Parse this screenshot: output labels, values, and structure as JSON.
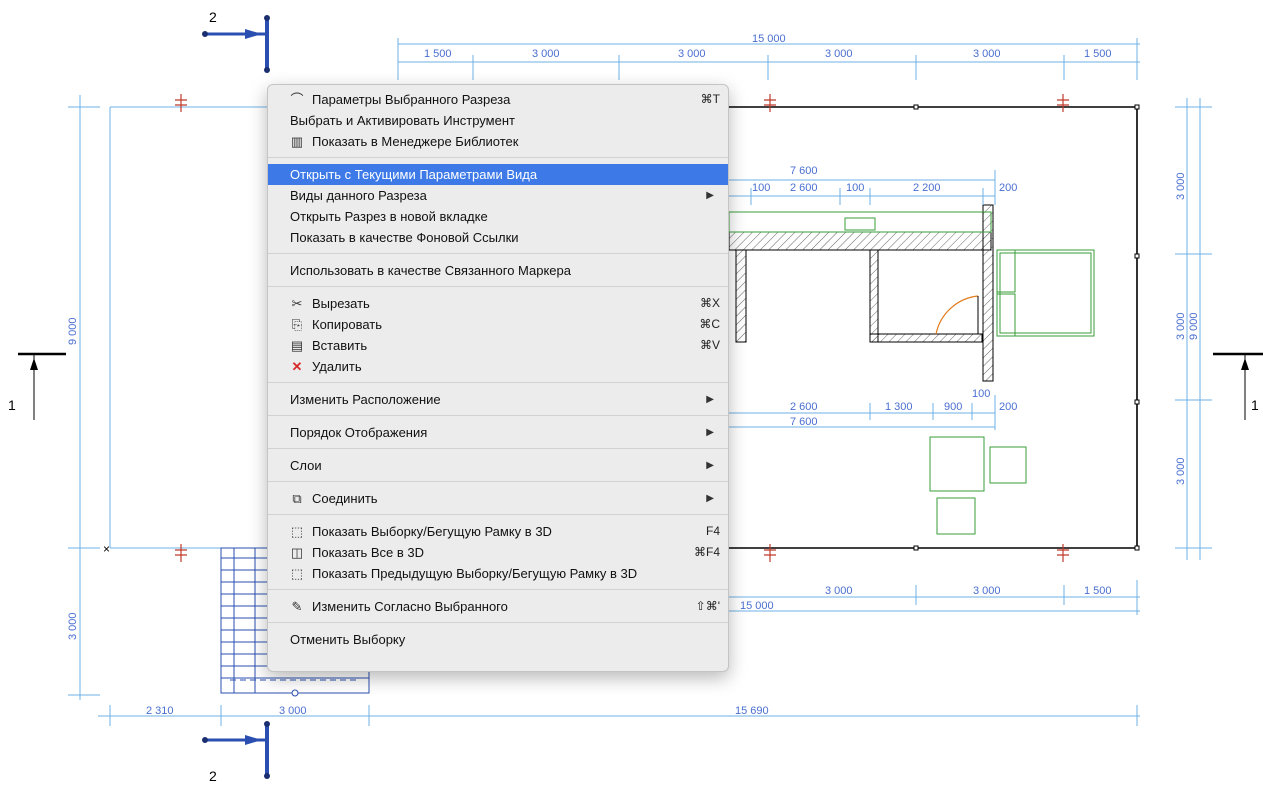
{
  "drawing": {
    "top_dims": {
      "total": "15 000",
      "segments": [
        "1 500",
        "3 000",
        "3 000",
        "3 000",
        "3 000",
        "1 500"
      ]
    },
    "bottom_dims": {
      "total": "15 000",
      "segments": [
        "3 000",
        "3 000",
        "1 500"
      ]
    },
    "bottom_outer_dims": [
      "2 310",
      "3 000",
      "15 690"
    ],
    "left_dims": [
      "9 000",
      "3 000"
    ],
    "right_dims": [
      "3 000",
      "3 000",
      "9 000",
      "3 000"
    ],
    "inner_top_dims": {
      "total": "7 600",
      "segments": [
        "100",
        "2 600",
        "100",
        "2 200",
        "200"
      ]
    },
    "inner_bottom_dims": {
      "total": "7 600",
      "segments": [
        "2 600",
        "1 300",
        "900",
        "100",
        "200"
      ]
    },
    "section_markers": {
      "top_left": "2",
      "bottom_left": "2",
      "left": "1",
      "right": "1"
    }
  },
  "context_menu": {
    "items": [
      {
        "id": "section-settings",
        "icon": "section-settings-icon",
        "glyph": "⌒",
        "label": "Параметры Выбранного Разреза",
        "shortcut": "⌘T"
      },
      {
        "id": "select-activate-tool",
        "label": "Выбрать и Активировать Инструмент"
      },
      {
        "id": "show-in-library-manager",
        "icon": "library-icon",
        "glyph": "▥",
        "label": "Показать в Менеджере Библиотек"
      },
      {
        "sep": true
      },
      {
        "id": "open-current-view",
        "label": "Открыть с Текущими Параметрами Вида",
        "highlighted": true
      },
      {
        "id": "section-views",
        "label": "Виды данного Разреза",
        "submenu": true
      },
      {
        "id": "open-new-tab",
        "label": "Открыть Разрез в новой вкладке"
      },
      {
        "id": "show-as-trace",
        "label": "Показать в качестве Фоновой Ссылки"
      },
      {
        "sep": true
      },
      {
        "id": "use-as-linked-marker",
        "label": "Использовать в качестве Связанного Маркера"
      },
      {
        "sep": true
      },
      {
        "id": "cut",
        "icon": "scissors-icon",
        "glyph": "✂",
        "label": "Вырезать",
        "shortcut": "⌘X"
      },
      {
        "id": "copy",
        "icon": "copy-icon",
        "glyph": "⎘",
        "label": "Копировать",
        "shortcut": "⌘C"
      },
      {
        "id": "paste",
        "icon": "clipboard-icon",
        "glyph": "▤",
        "label": "Вставить",
        "shortcut": "⌘V"
      },
      {
        "id": "delete",
        "icon": "delete-x-icon",
        "glyph": "✕",
        "label": "Удалить",
        "red": true
      },
      {
        "sep": true
      },
      {
        "id": "arrange",
        "label": "Изменить Расположение",
        "submenu": true
      },
      {
        "sep": true
      },
      {
        "id": "display-order",
        "label": "Порядок Отображения",
        "submenu": true
      },
      {
        "sep": true
      },
      {
        "id": "layers",
        "label": "Слои",
        "submenu": true
      },
      {
        "sep": true
      },
      {
        "id": "connect",
        "icon": "connect-icon",
        "glyph": "⧉",
        "label": "Соединить",
        "submenu": true
      },
      {
        "sep": true
      },
      {
        "id": "show-selection-3d",
        "icon": "cube-dashed-icon",
        "glyph": "⬚",
        "label": "Показать Выборку/Бегущую Рамку в 3D",
        "shortcut": "F4"
      },
      {
        "id": "show-all-3d",
        "icon": "cube-icon",
        "glyph": "◫",
        "label": "Показать Все в 3D",
        "shortcut": "⌘F4"
      },
      {
        "id": "show-prev-selection-3d",
        "icon": "cube-dashed-prev-icon",
        "glyph": "⬚",
        "label": "Показать Предыдущую Выборку/Бегущую Рамку в 3D"
      },
      {
        "sep": true
      },
      {
        "id": "modify-by-selection",
        "icon": "eyedropper-icon",
        "glyph": "✎",
        "label": "Изменить Согласно Выбранного",
        "shortcut": "⇧⌘'"
      },
      {
        "sep": true
      },
      {
        "id": "deselect",
        "label": "Отменить Выборку"
      }
    ]
  },
  "colors": {
    "menu_highlight": "#3d7ae8",
    "dimension_text": "#4a6fd0",
    "dimension_line": "#6fb2e6",
    "furniture": "#3a9e3a",
    "marker": "#c0392b",
    "section_selected": "#2a4fb0"
  }
}
